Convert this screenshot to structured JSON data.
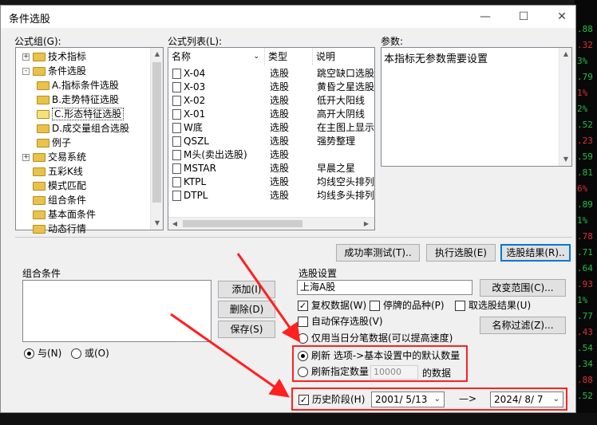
{
  "window": {
    "title": "条件选股"
  },
  "formula_group": {
    "label": "公式组(G):",
    "tree": [
      {
        "label": "技术指标",
        "level": 0,
        "expander": "+"
      },
      {
        "label": "条件选股",
        "level": 0,
        "expander": "-"
      },
      {
        "label": "A.指标条件选股",
        "level": 1
      },
      {
        "label": "B.走势特征选股",
        "level": 1
      },
      {
        "label": "C.形态特征选股",
        "level": 1,
        "selected": true
      },
      {
        "label": "D.成交量组合选股",
        "level": 1
      },
      {
        "label": "例子",
        "level": 1
      },
      {
        "label": "交易系统",
        "level": 0,
        "expander": "+"
      },
      {
        "label": "五彩K线",
        "level": 0
      },
      {
        "label": "模式匹配",
        "level": 0
      },
      {
        "label": "组合条件",
        "level": 0
      },
      {
        "label": "基本面条件",
        "level": 0
      },
      {
        "label": "动态行情",
        "level": 0
      }
    ]
  },
  "formula_list": {
    "label": "公式列表(L):",
    "columns": [
      "名称",
      "类型",
      "说明"
    ],
    "rows": [
      {
        "name": "X-04",
        "type": "选股",
        "desc": "跳空缺口选股"
      },
      {
        "name": "X-03",
        "type": "选股",
        "desc": "黄昏之星选股"
      },
      {
        "name": "X-02",
        "type": "选股",
        "desc": "低开大阳线"
      },
      {
        "name": "X-01",
        "type": "选股",
        "desc": "高开大阴线"
      },
      {
        "name": "W底",
        "type": "选股",
        "desc": "在主图上显示"
      },
      {
        "name": "QSZL",
        "type": "选股",
        "desc": "强势整理"
      },
      {
        "name": "M头(卖出选股)",
        "type": "选股",
        "desc": ""
      },
      {
        "name": "MSTAR",
        "type": "选股",
        "desc": "早晨之星"
      },
      {
        "name": "KTPL",
        "type": "选股",
        "desc": "均线空头排列"
      },
      {
        "name": "DTPL",
        "type": "选股",
        "desc": "均线多头排列"
      }
    ]
  },
  "params": {
    "label": "参数:",
    "text": "本指标无参数需要设置"
  },
  "buttons": {
    "success_test": "成功率测试(T)..",
    "execute": "执行选股(E)",
    "results": "选股结果(R)..",
    "add": "添加(I)",
    "delete": "删除(D)",
    "save": "保存(S)",
    "change_range": "改变范围(C)...",
    "name_filter": "名称过滤(Z)..."
  },
  "combo_condition": {
    "label": "组合条件",
    "and_label": "与(N)",
    "or_label": "或(O)"
  },
  "selection": {
    "label": "选股设置",
    "range_value": "上海A股",
    "restore_rights": "复权数据(W)",
    "suspended": "停牌的品种(P)",
    "take_result": "取选股结果(U)",
    "auto_save": "自动保存选股(V)",
    "only_today": "仅用当日分笔数据(可以提高速度)",
    "refresh_default": "刷新 选项->基本设置中的默认数量",
    "refresh_count_prefix": "刷新指定数量",
    "refresh_count_value": "10000",
    "refresh_count_suffix": "的数据",
    "history": "历史阶段(H)",
    "date_from": "2001/ 5/13",
    "arrow": "—>",
    "date_to": "2024/ 8/ 7"
  },
  "background": {
    "right_numbers": [
      ".88",
      ".32",
      "3%",
      ".79",
      "1%",
      "2%",
      ".52",
      ".23",
      ".59",
      ".81",
      "6%",
      ".89",
      "1%",
      ".78",
      ".71",
      ".64",
      ".93",
      "1%",
      ".77",
      ".43",
      ".54",
      ".34",
      ".88",
      ".52"
    ]
  },
  "colors": {
    "annotation": "#ff2020",
    "accent": "#0078d7"
  }
}
